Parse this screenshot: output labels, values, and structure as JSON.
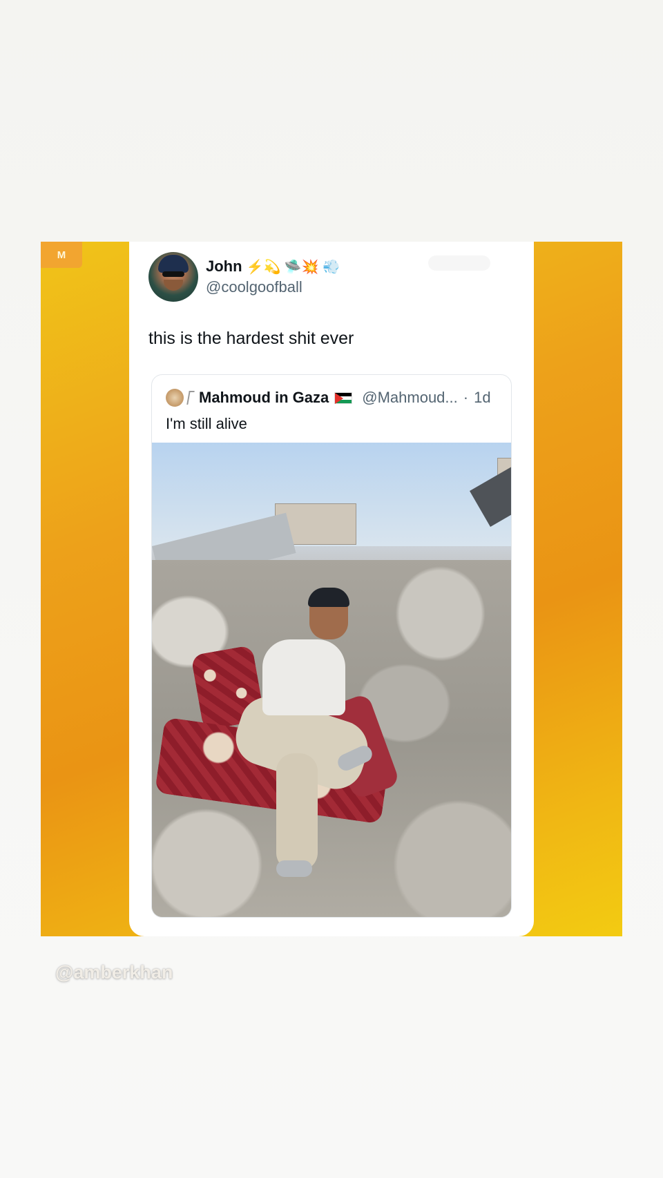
{
  "poster": {
    "logo_text": "M",
    "gradient_colors": [
      "#f0c419",
      "#ea9414",
      "#f3cb12"
    ]
  },
  "tweet": {
    "author": {
      "name": "John",
      "emojis": "⚡️💫 🛸💥 💨",
      "handle": "@coolgoofball"
    },
    "text": "this is the hardest shit ever",
    "quote": {
      "name": "Mahmoud in Gaza",
      "handle": "@Mahmoud...",
      "separator": "·",
      "time": "1d",
      "text": "I'm still alive",
      "media_icon": "photo-of-man-sitting-on-rubble"
    }
  },
  "watermark": "@amberkhan"
}
